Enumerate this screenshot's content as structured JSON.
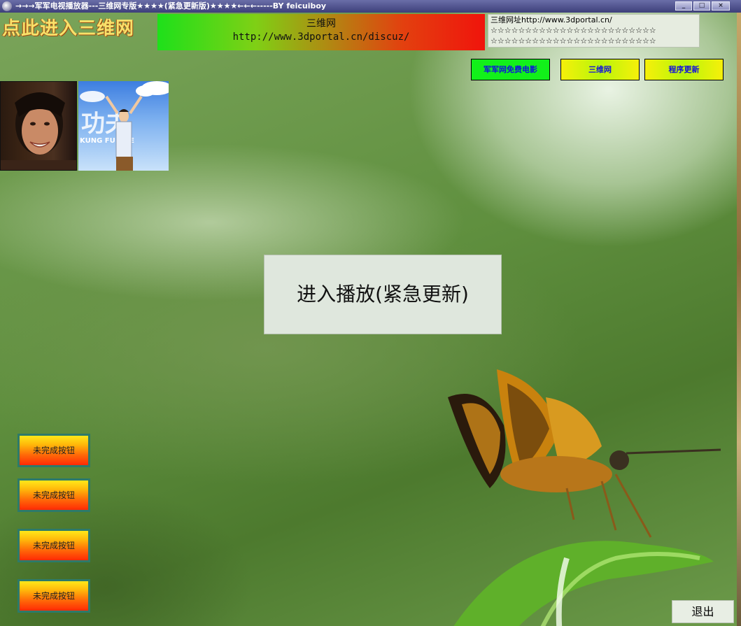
{
  "window": {
    "title": "→→→军军电视播放器---三维网专版★★★★(紧急更新版)★★★★←←←-----BY feicuiboy",
    "controls": {
      "minimize": "_",
      "maximize": "□",
      "close": "×"
    }
  },
  "header": {
    "enter_link": "点此进入三维网",
    "banner": {
      "line1": "三维网",
      "line2": "http://www.3dportal.cn/discuz/"
    },
    "info": {
      "line1": "三维网址http://www.3dportal.cn/",
      "line2": "☆☆☆☆☆☆☆☆☆☆☆☆☆☆☆☆☆☆☆☆☆☆☆☆",
      "line3": "☆☆☆☆☆☆☆☆☆☆☆☆☆☆☆☆☆☆☆☆☆☆☆☆"
    }
  },
  "nav_buttons": [
    {
      "label": "军军网免费电影",
      "color": "#12f01a"
    },
    {
      "label": "三维网",
      "color": "#f6f00a"
    },
    {
      "label": "程序更新",
      "color": "#f6f00a"
    }
  ],
  "photos": {
    "photo2_text": "功夫",
    "photo2_caption": "KUNG FUSTLE"
  },
  "main": {
    "play_button": "进入播放(紧急更新)"
  },
  "side_buttons": [
    {
      "label": "未完成按钮"
    },
    {
      "label": "未完成按钮"
    },
    {
      "label": "未完成按钮"
    },
    {
      "label": "未完成按钮"
    }
  ],
  "footer": {
    "exit_button": "退出"
  }
}
